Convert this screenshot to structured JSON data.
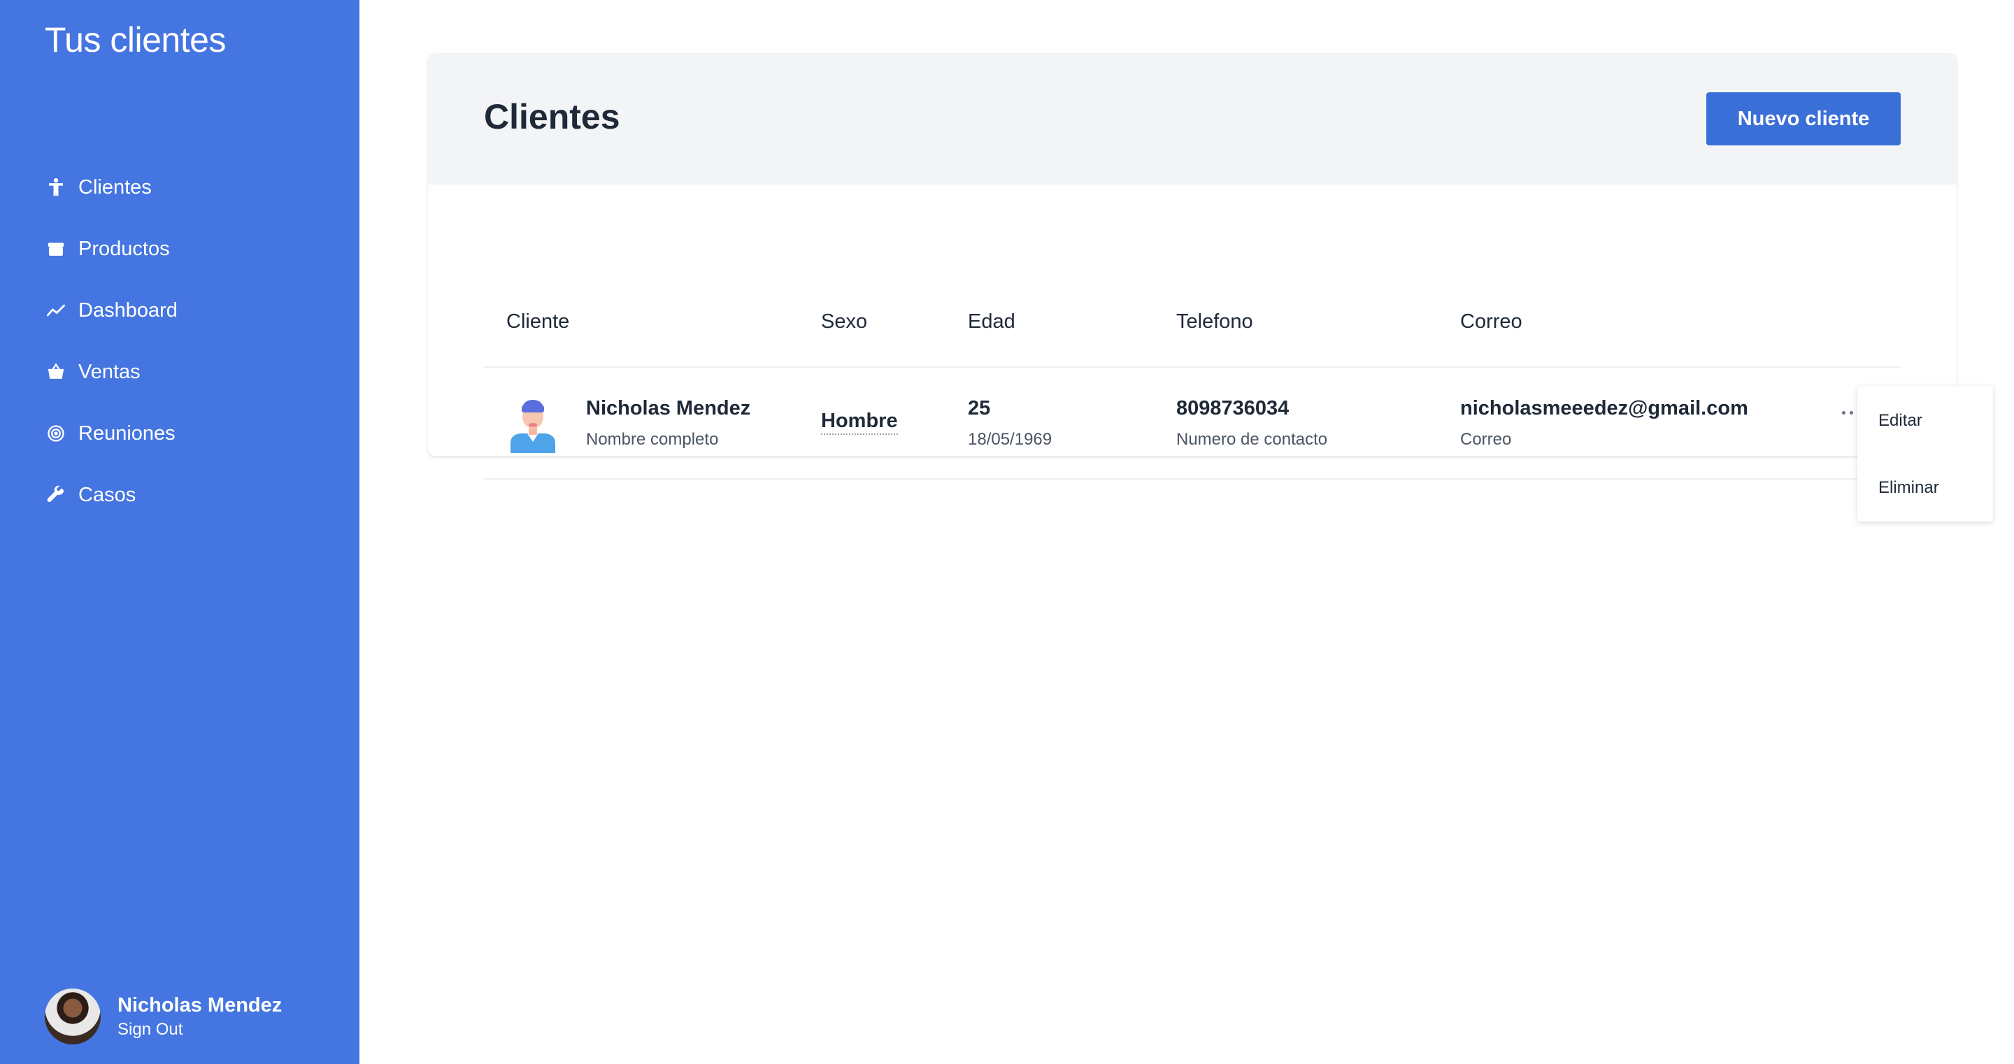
{
  "sidebar": {
    "app_title": "Tus clientes",
    "items": [
      {
        "label": "Clientes",
        "icon": "person-accessibility-icon"
      },
      {
        "label": "Productos",
        "icon": "box-icon"
      },
      {
        "label": "Dashboard",
        "icon": "trend-line-icon"
      },
      {
        "label": "Ventas",
        "icon": "basket-icon"
      },
      {
        "label": "Reuniones",
        "icon": "target-icon"
      },
      {
        "label": "Casos",
        "icon": "wrench-icon"
      }
    ],
    "user": {
      "name": "Nicholas Mendez",
      "sign_out": "Sign Out"
    }
  },
  "main": {
    "title": "Clientes",
    "new_button": "Nuevo cliente",
    "table": {
      "headers": [
        "Cliente",
        "Sexo",
        "Edad",
        "Telefono",
        "Correo"
      ],
      "rows": [
        {
          "name": "Nicholas Mendez",
          "name_caption": "Nombre completo",
          "sex": "Hombre",
          "age": "25",
          "birthdate": "18/05/1969",
          "phone": "8098736034",
          "phone_caption": "Numero de contacto",
          "email": "nicholasmeeedez@gmail.com",
          "email_caption": "Correo"
        }
      ]
    },
    "row_menu": {
      "items": [
        "Editar",
        "Eliminar"
      ]
    }
  },
  "colors": {
    "sidebar_bg": "#4475e0",
    "primary_button": "#3b6fd8",
    "header_bg": "#f3f4f6"
  }
}
